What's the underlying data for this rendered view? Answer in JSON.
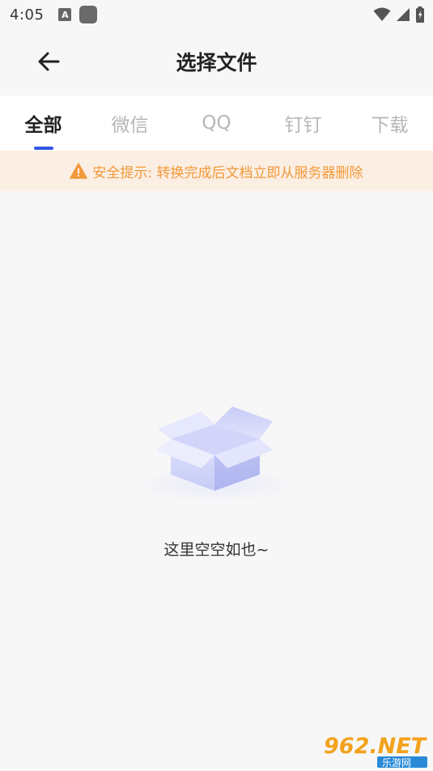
{
  "status_bar": {
    "time": "4:05",
    "notification_letter": "A"
  },
  "header": {
    "title": "选择文件"
  },
  "tabs": [
    {
      "label": "全部",
      "active": true
    },
    {
      "label": "微信",
      "active": false
    },
    {
      "label": "QQ",
      "active": false
    },
    {
      "label": "钉钉",
      "active": false
    },
    {
      "label": "下载",
      "active": false
    }
  ],
  "notice": {
    "text": "安全提示: 转换完成后文档立即从服务器删除"
  },
  "empty_state": {
    "text": "这里空空如也~"
  },
  "watermark": {
    "main": "962.NET",
    "sub": "乐游网"
  },
  "colors": {
    "accent": "#3355e6",
    "notice_text": "#f2993a",
    "notice_bg": "#fbeee2",
    "box": "#c7cbf7"
  }
}
